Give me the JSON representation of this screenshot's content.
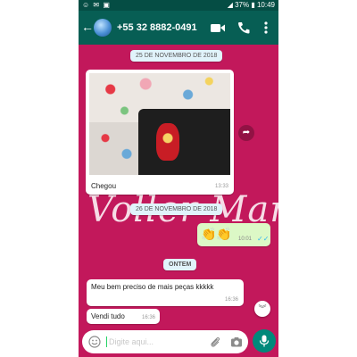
{
  "status_bar": {
    "left_icons": "☺ ✉ ▣",
    "battery": "37%",
    "time": "10:49"
  },
  "header": {
    "back_icon": "arrow-left-icon",
    "contact_name": "+55 32 8882-0491",
    "actions": [
      "video-call-icon",
      "phone-icon",
      "more-vert-icon"
    ]
  },
  "chat": {
    "watermark_text": "Voller Mani",
    "date_chip_1": "25 DE NOVEMBRO DE 2018",
    "image_message": {
      "caption": "Chegou",
      "time": "13:33"
    },
    "date_chip_2": "26 DE NOVEMBRO DE 2018",
    "clap_message": {
      "emoji": "👏👏",
      "time": "10:01",
      "ticks": "✓✓"
    },
    "date_chip_3": "ONTEM",
    "messages": [
      {
        "text": "Meu bem preciso de mais peças kkkkk",
        "time": "16:36"
      },
      {
        "text": "Vendi tudo",
        "time": "16:36"
      }
    ]
  },
  "input": {
    "placeholder": "Digite aqui..."
  },
  "colors": {
    "header": "#075e54",
    "wallpaper": "#c2185b",
    "outgoing_bubble": "#dcf8c6",
    "mic_button": "#00897b"
  }
}
